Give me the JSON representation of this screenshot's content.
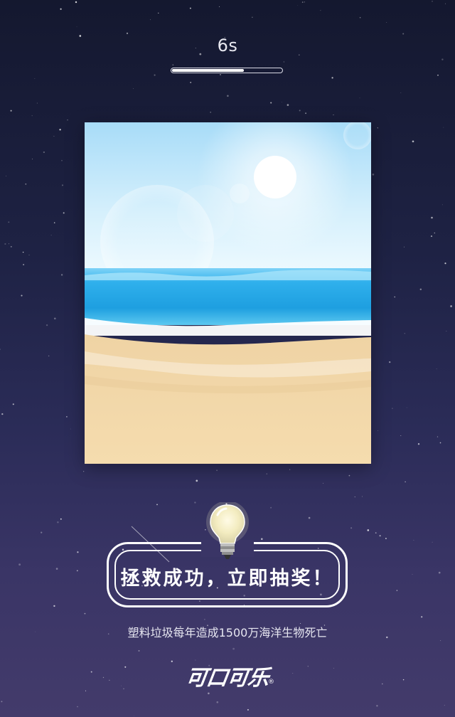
{
  "timer": {
    "label": "6s",
    "progress": 0.66
  },
  "scene": {
    "description_icon": "beach-scene-image"
  },
  "cta": {
    "label": "拯救成功，立即抽奖！",
    "icon": "lightbulb-icon"
  },
  "tagline": "塑料垃圾每年造成1500万海洋生物死亡",
  "brand": {
    "logo_text": "可口可乐",
    "registered_mark": "®"
  },
  "colors": {
    "background_top": "#14182f",
    "background_bottom": "#433b6b",
    "accent": "#ffffff",
    "sky": "#bfe6fb",
    "sea": "#2aa8e6",
    "sand": "#f2d7a6"
  }
}
